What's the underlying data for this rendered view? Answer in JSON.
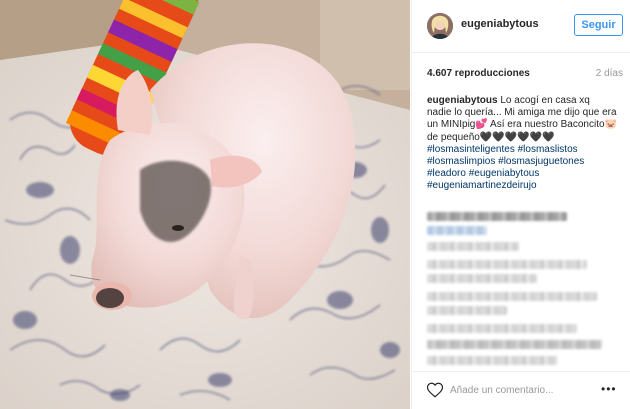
{
  "post": {
    "username": "eugeniabytous",
    "follow_label": "Seguir",
    "views": "4.607 reproducciones",
    "age": "2 días",
    "caption": {
      "user": "eugeniabytous",
      "text": "Lo acogí en casa xq nadie lo quería... Mi amiga me dijo que era un MINIpig💕 Así era nuestro Baconcito🐷de pequeño🖤🖤🖤🖤🖤🖤",
      "hashtags": [
        "#losmasinteligentes #losmaslistos",
        "#losmaslimpios #losmasjuguetones",
        "#leadoro #eugeniabytous",
        "#eugeniamartinezdeirujo"
      ]
    },
    "comment_placeholder": "Añade un comentario...",
    "more_label": "•••"
  },
  "icons": {
    "heart": "heart-icon",
    "more": "more-options-icon"
  },
  "colors": {
    "accent": "#3897f0",
    "hashtag": "#003569",
    "muted": "#999999",
    "text": "#262626"
  }
}
